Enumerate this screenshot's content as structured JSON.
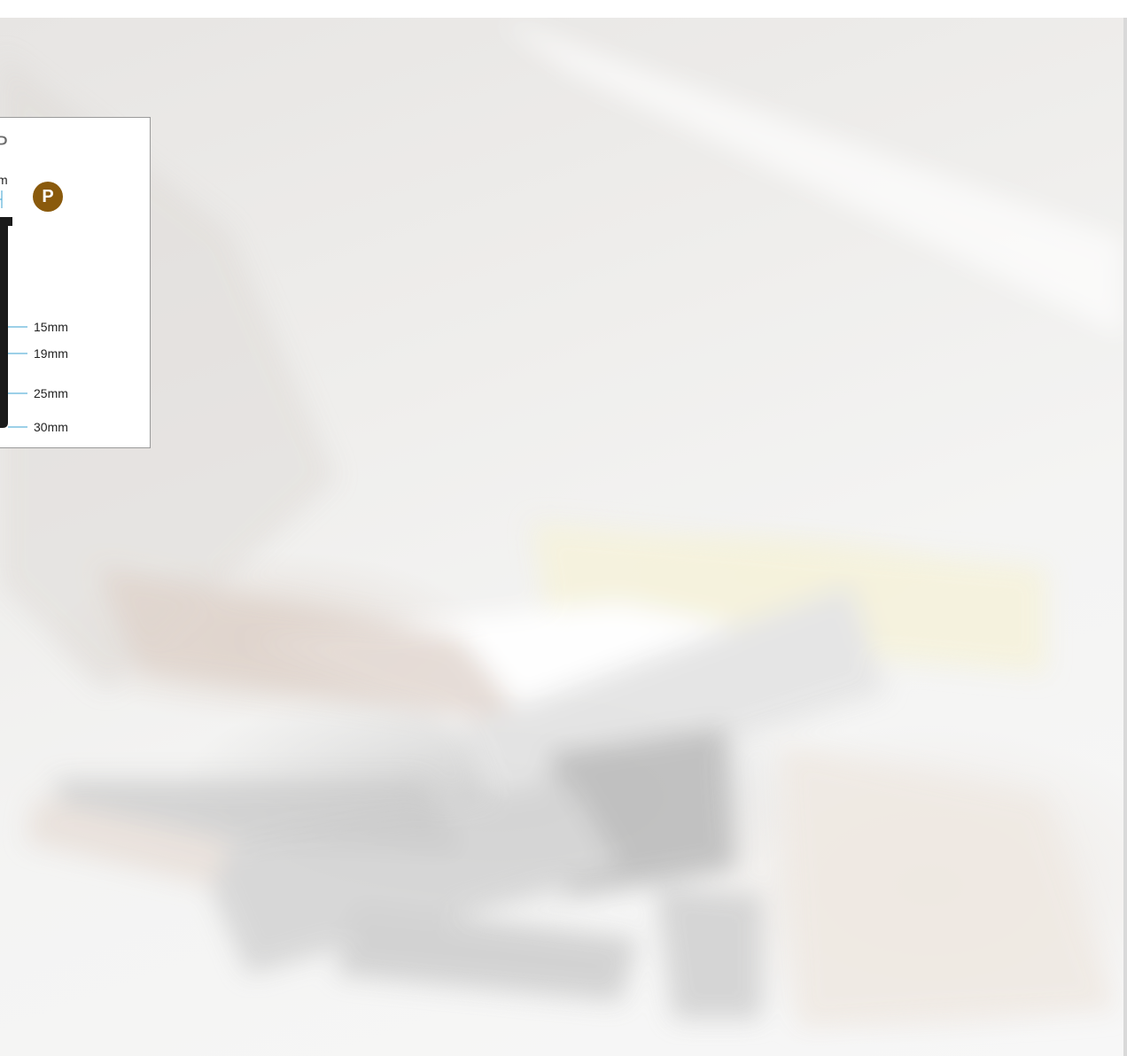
{
  "card": {
    "title": "P",
    "top_dimension": "m",
    "badge_letter": "P",
    "badge_color": "#8a5a0c",
    "line_color": "#3aa0d0",
    "dimensions": [
      "15mm",
      "19mm",
      "25mm",
      "30mm"
    ]
  }
}
